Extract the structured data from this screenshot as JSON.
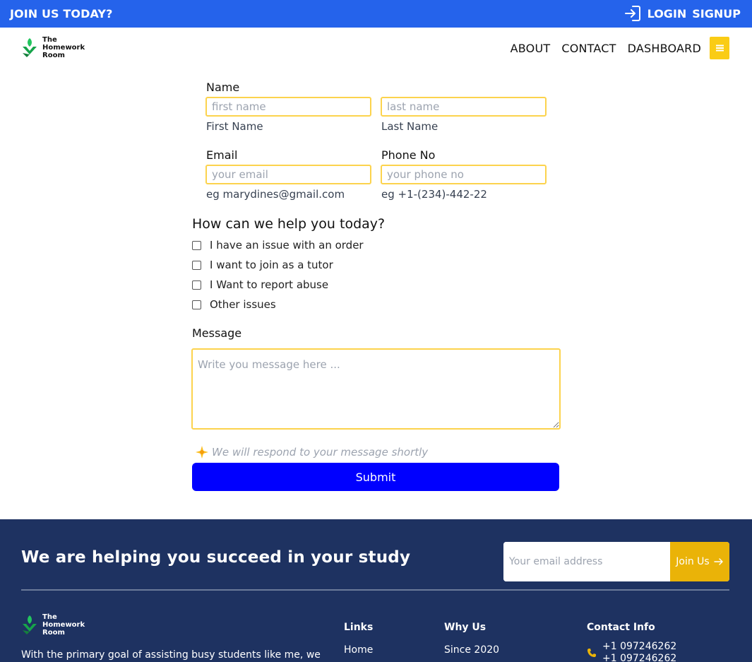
{
  "topbar": {
    "join_label": "JOIN US TODAY?",
    "login_label": "LOGIN",
    "signup_label": "SIGNUP"
  },
  "brand": {
    "line1": "The",
    "line2": "Homework",
    "line3": "Room"
  },
  "nav": {
    "about": "ABOUT",
    "contact": "CONTACT",
    "dashboard": "DASHBOARD"
  },
  "form": {
    "name_label": "Name",
    "first_placeholder": "first name",
    "first_hint": "First Name",
    "last_placeholder": "last name",
    "last_hint": "Last Name",
    "email_label": "Email",
    "email_placeholder": "your email",
    "email_hint": "eg marydines@gmail.com",
    "phone_label": "Phone No",
    "phone_placeholder": "your phone no",
    "phone_hint": "eg +1-(234)-442-22",
    "help_title": "How can we help you today?",
    "options": [
      {
        "label": "I have an issue with an order",
        "checked": false
      },
      {
        "label": "I want to join as a tutor",
        "checked": false
      },
      {
        "label": "I Want to report abuse",
        "checked": false
      },
      {
        "label": "Other issues",
        "checked": false
      }
    ],
    "message_label": "Message",
    "message_placeholder": "Write you message here ...",
    "respond_note": "We will respond to your message shortly",
    "submit_label": "Submit"
  },
  "footer": {
    "tagline": "We are helping you succeed in your study",
    "subscribe_placeholder": "Your email address",
    "subscribe_button": "Join Us",
    "about_text": "With the primary goal of assisting busy students like me, we",
    "links_title": "Links",
    "links_first": "Home",
    "why_title": "Why Us",
    "why_first": "Since 2020",
    "contact_title": "Contact Info",
    "phone1": "+1 097246262",
    "phone2": "+1 097246262"
  },
  "colors": {
    "topbar": "#2563eb",
    "accent_yellow": "#facc15",
    "submit_blue": "#0000ff",
    "footer_bg": "#1e3261"
  }
}
